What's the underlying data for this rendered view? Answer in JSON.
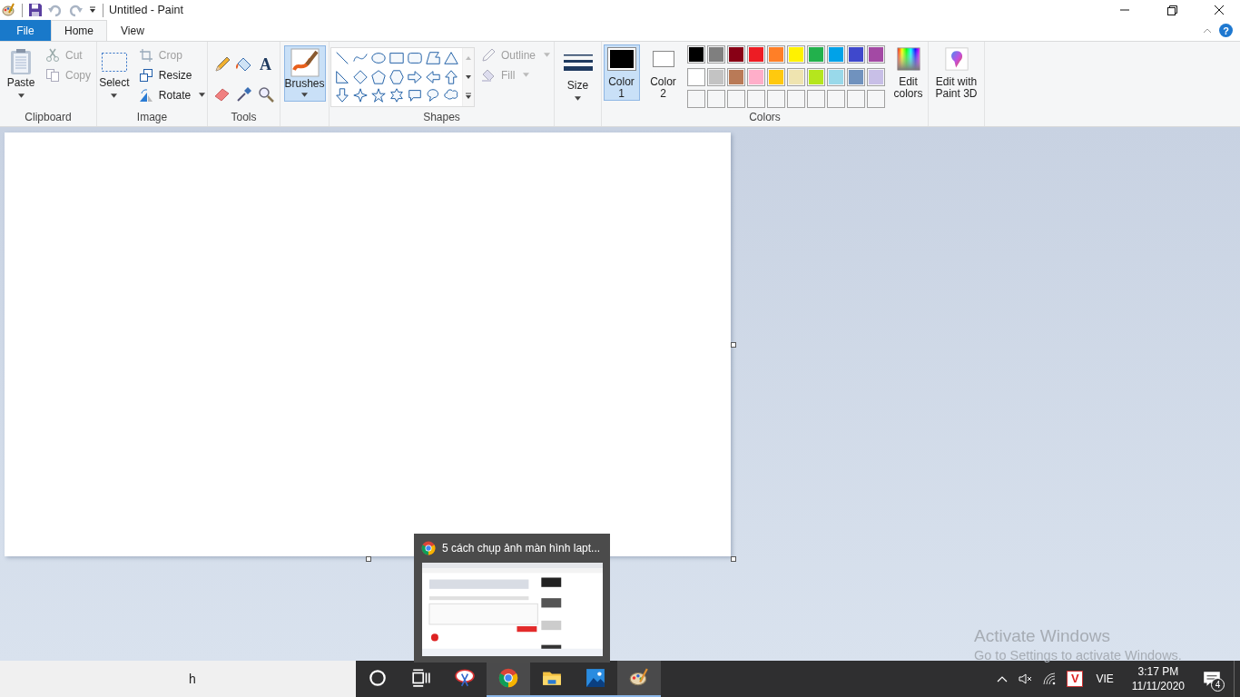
{
  "title_bar": {
    "title": "Untitled - Paint"
  },
  "tabs": [
    {
      "label": "File",
      "selected": false,
      "kind": "file"
    },
    {
      "label": "Home",
      "selected": true,
      "kind": "tab"
    },
    {
      "label": "View",
      "selected": false,
      "kind": "tab"
    }
  ],
  "help": "?",
  "clipboard": {
    "label": "Clipboard",
    "paste": "Paste",
    "cut": {
      "label": "Cut",
      "disabled": true
    },
    "copy": {
      "label": "Copy",
      "disabled": true
    }
  },
  "image": {
    "label": "Image",
    "select": "Select",
    "crop": {
      "label": "Crop",
      "disabled": true
    },
    "resize": {
      "label": "Resize",
      "disabled": false
    },
    "rotate": {
      "label": "Rotate",
      "disabled": false
    }
  },
  "tools": {
    "label": "Tools",
    "text_glyph": "A"
  },
  "brushes": {
    "label": "Brushes",
    "selected": true
  },
  "shapes": {
    "label": "Shapes",
    "outline": {
      "label": "Outline",
      "disabled": true
    },
    "fill": {
      "label": "Fill",
      "disabled": true
    }
  },
  "size": {
    "label": "Size"
  },
  "colors": {
    "label": "Colors",
    "color1": {
      "label": "Color 1",
      "selected": true,
      "color": "#000000"
    },
    "color2": {
      "label": "Color 2",
      "selected": false,
      "color": "#ffffff"
    },
    "palette": [
      {
        "color": "#000000"
      },
      {
        "color": "#7f7f7f"
      },
      {
        "color": "#880015"
      },
      {
        "color": "#ed1c24"
      },
      {
        "color": "#ff7f27"
      },
      {
        "color": "#fff200"
      },
      {
        "color": "#22b14c"
      },
      {
        "color": "#00a2e8"
      },
      {
        "color": "#3f48cc"
      },
      {
        "color": "#a349a4"
      },
      {
        "color": "#ffffff"
      },
      {
        "color": "#c3c3c3"
      },
      {
        "color": "#b97a57"
      },
      {
        "color": "#ffaec9"
      },
      {
        "color": "#ffc90e"
      },
      {
        "color": "#efe4b0"
      },
      {
        "color": "#b5e61d"
      },
      {
        "color": "#99d9ea"
      },
      {
        "color": "#7092be"
      },
      {
        "color": "#c8bfe7"
      }
    ],
    "edit": "Edit colors"
  },
  "paint3d": {
    "label": "Edit with Paint 3D"
  },
  "preview": {
    "title": "5 cách chụp ảnh màn hình lapt..."
  },
  "activation": {
    "title": "Activate Windows",
    "hint": "Go to Settings to activate Windows."
  },
  "taskbar": {
    "search": "h",
    "apps": [
      {
        "kind": "cortana",
        "running": false,
        "selected": false
      },
      {
        "kind": "task_view",
        "running": false,
        "selected": false
      },
      {
        "kind": "snipping",
        "running": false,
        "selected": false
      },
      {
        "kind": "chrome",
        "running": true,
        "selected": true
      },
      {
        "kind": "explorer",
        "running": true,
        "selected": false
      },
      {
        "kind": "photos",
        "running": true,
        "selected": false
      },
      {
        "kind": "paint",
        "running": true,
        "selected": true
      }
    ],
    "tray": {
      "v_glyph": "V",
      "language": "VIE",
      "time": "3:17 PM",
      "date": "11/11/2020",
      "notifications": "4"
    }
  }
}
